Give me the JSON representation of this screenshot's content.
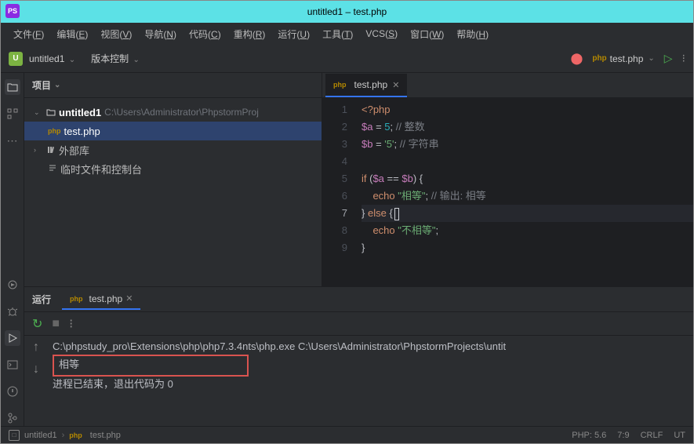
{
  "title": "untitled1 – test.php",
  "menubar": [
    {
      "label": "文件",
      "key": "F"
    },
    {
      "label": "编辑",
      "key": "E"
    },
    {
      "label": "视图",
      "key": "V"
    },
    {
      "label": "导航",
      "key": "N"
    },
    {
      "label": "代码",
      "key": "C"
    },
    {
      "label": "重构",
      "key": "R"
    },
    {
      "label": "运行",
      "key": "U"
    },
    {
      "label": "工具",
      "key": "T"
    },
    {
      "label": "VCS",
      "key": "S"
    },
    {
      "label": "窗口",
      "key": "W"
    },
    {
      "label": "帮助",
      "key": "H"
    }
  ],
  "toolbar": {
    "project_badge": "U",
    "project_name": "untitled1",
    "version_control": "版本控制",
    "run_config": "test.php",
    "php_indicator": "php"
  },
  "project_panel": {
    "title": "项目",
    "root": "untitled1",
    "root_path": "C:\\Users\\Administrator\\PhpstormProj",
    "file": "test.php",
    "ext_libs": "外部库",
    "scratches": "临时文件和控制台"
  },
  "editor": {
    "tab": "test.php",
    "lines": [
      1,
      2,
      3,
      4,
      5,
      6,
      7,
      8,
      9
    ],
    "active_line": 7,
    "code": {
      "l1": "<?php",
      "l2_var": "$a",
      "l2_rest": " = 5; ",
      "l2_cm": "// 整数",
      "l3_var": "$b",
      "l3_rest": " = '5'; ",
      "l3_cm": "// 字符串",
      "l5_if": "if",
      "l5_open": " (",
      "l5_a": "$a",
      "l5_eq": " == ",
      "l5_b": "$b",
      "l5_close": ") {",
      "l6_echo": "echo",
      "l6_str": " \"相等\"",
      "l6_semi": "; ",
      "l6_cm": "// 输出: 相等",
      "l7_close": "} ",
      "l7_else": "else",
      "l7_brace": " {",
      "l8_echo": "echo",
      "l8_str": " \"不相等\"",
      "l8_semi": ";",
      "l9": "}"
    }
  },
  "run_panel": {
    "label": "运行",
    "tab": "test.php",
    "cmd": "C:\\phpstudy_pro\\Extensions\\php\\php7.3.4nts\\php.exe C:\\Users\\Administrator\\PhpstormProjects\\untit",
    "output": "相等",
    "exit": "进程已结束，退出代码为 0"
  },
  "statusbar": {
    "crumb1": "untitled1",
    "crumb2": "test.php",
    "php_ver": "PHP: 5.6",
    "pos": "7:9",
    "crlf": "CRLF",
    "enc": "UT"
  },
  "icons": {
    "chev_down": "⌄",
    "play": "▷"
  }
}
